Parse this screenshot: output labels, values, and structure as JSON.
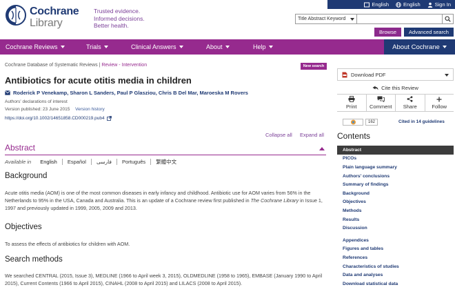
{
  "header": {
    "brand_line1": "Cochrane",
    "brand_line2": "Library",
    "tagline": [
      "Trusted evidence.",
      "Informed decisions.",
      "Better health."
    ],
    "top_links": [
      {
        "label": "English",
        "icon": "flag-icon"
      },
      {
        "label": "English",
        "icon": "globe-icon"
      },
      {
        "label": "Sign In",
        "icon": "user-icon"
      }
    ],
    "search": {
      "select_value": "Title Abstract Keyword",
      "input_value": "",
      "input_placeholder": ""
    },
    "browse_label": "Browse",
    "advanced_label": "Advanced search"
  },
  "nav": {
    "items": [
      "Cochrane Reviews",
      "Trials",
      "Clinical Answers",
      "About",
      "Help"
    ],
    "about_cochrane": "About Cochrane"
  },
  "article": {
    "database": "Cochrane Database of Systematic Reviews",
    "separator": " | ",
    "review_type": "Review - Intervention",
    "new_search": "New search",
    "title": "Antibiotics for acute otitis media in children",
    "authors": "Roderick P Venekamp, Sharon L Sanders, Paul P Glasziou, Chris B Del Mar, Maroeska M Rovers",
    "declarations": "Authors' declarations of interest",
    "version_published": "Version published: 23 June 2015",
    "version_history": "Version history",
    "doi": "https://doi.org/10.1002/14651858.CD000219.pub4",
    "collapse_all": "Collapse all",
    "expand_all": "Expand all"
  },
  "abstract": {
    "title": "Abstract",
    "available_in": "Available in",
    "languages": [
      "English",
      "Español",
      "فارسی",
      "Português",
      "繁體中文"
    ],
    "background_h": "Background",
    "background_p1": "Acute otitis media (AOM) is one of the most common diseases in early infancy and childhood. Antibiotic use for AOM varies from 56% in the Netherlands to 95% in the USA, Canada and Australia. This is an update of a Cochrane review first published in ",
    "background_italic": "The Cochrane Library",
    "background_p2": " in Issue 1, 1997 and previously updated in 1999, 2005, 2009 and 2013.",
    "objectives_h": "Objectives",
    "objectives_p": "To assess the effects of antibiotics for children with AOM.",
    "search_h": "Search methods",
    "search_p": "We searched CENTRAL (2015, Issue 3), MEDLINE (1966 to April week 3, 2015), OLDMEDLINE (1958 to 1965), EMBASE (January 1990 to April 2015), Current Contents (1966 to April 2015), CINAHL (2008 to April 2015) and LILACS (2008 to April 2015)."
  },
  "sidebar": {
    "download_pdf": "Download PDF",
    "cite": "Cite this Review",
    "actions": [
      {
        "label": "Print",
        "icon": "print-icon"
      },
      {
        "label": "Comment",
        "icon": "comment-icon"
      },
      {
        "label": "Share",
        "icon": "share-icon"
      },
      {
        "label": "Follow",
        "icon": "plus-icon"
      }
    ],
    "altmetric_count": "162",
    "cited": "Cited in 14 guidelines",
    "contents_title": "Contents",
    "contents": [
      "Abstract",
      "PICOs",
      "Plain language summary",
      "Authors' conclusions",
      "Summary of findings",
      "Background",
      "Objectives",
      "Methods",
      "Results",
      "Discussion"
    ],
    "contents_more": [
      "Appendices",
      "Figures and tables",
      "References",
      "Characteristics of studies",
      "Data and analyses",
      "Download statistical data"
    ]
  },
  "colors": {
    "navy": "#1f3a74",
    "purple": "#962a8e",
    "dark": "#3c3c3c"
  }
}
